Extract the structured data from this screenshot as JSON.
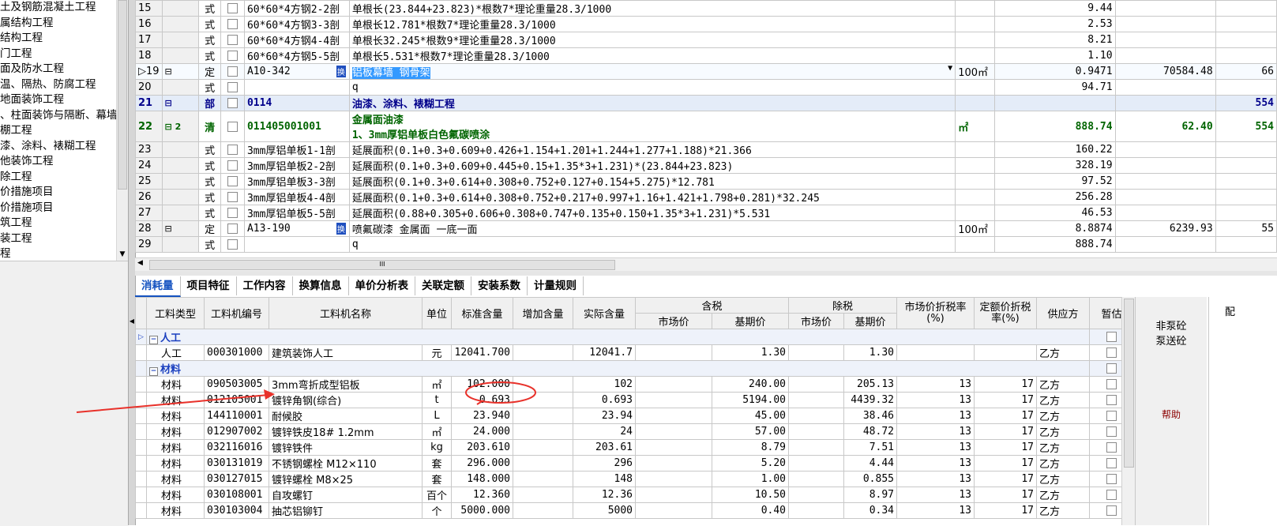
{
  "tree": {
    "items": [
      "土及钢筋混凝土工程",
      "属结构工程",
      "结构工程",
      "门工程",
      "面及防水工程",
      "温、隔热、防腐工程",
      "地面装饰工程",
      "、柱面装饰与隔断、幕墙",
      "棚工程",
      "漆、涂料、裱糊工程",
      "他装饰工程",
      "除工程",
      "价措施项目",
      "价措施项目",
      "筑工程",
      "装工程",
      "程"
    ]
  },
  "top_grid": {
    "rows": [
      {
        "num": "15",
        "indent": "",
        "type": "式",
        "code": "60*60*4方钢2-2剖",
        "name": "单根长(23.844+23.823)*根数7*理论重量28.3/1000",
        "unit": "",
        "qty": "9.44",
        "price": "",
        "extra": ""
      },
      {
        "num": "16",
        "indent": "",
        "type": "式",
        "code": "60*60*4方钢3-3剖",
        "name": "单根长12.781*根数7*理论重量28.3/1000",
        "unit": "",
        "qty": "2.53",
        "price": "",
        "extra": ""
      },
      {
        "num": "17",
        "indent": "",
        "type": "式",
        "code": "60*60*4方钢4-4剖",
        "name": "单根长32.245*根数9*理论重量28.3/1000",
        "unit": "",
        "qty": "8.21",
        "price": "",
        "extra": ""
      },
      {
        "num": "18",
        "indent": "",
        "type": "式",
        "code": "60*60*4方钢5-5剖",
        "name": "单根长5.531*根数7*理论重量28.3/1000",
        "unit": "",
        "qty": "1.10",
        "price": "",
        "extra": ""
      },
      {
        "num": "▷19",
        "indent": "⊟",
        "type": "定",
        "code": "A10-342",
        "tag": "换",
        "name": "铝板幕墙 钢骨架",
        "unit": "100㎡",
        "qty": "0.9471",
        "price": "70584.48",
        "extra": "66",
        "selected": true
      },
      {
        "num": "20",
        "indent": "",
        "type": "式",
        "code": "",
        "name": "q",
        "unit": "",
        "qty": "94.71",
        "price": "",
        "extra": ""
      },
      {
        "num": "21",
        "indent": "⊟",
        "type": "部",
        "code": "0114",
        "name": "油漆、涂料、裱糊工程",
        "unit": "",
        "qty": "",
        "price": "",
        "extra": "554",
        "dept": true
      },
      {
        "num": "22",
        "indent": "⊟ 2",
        "type": "清",
        "code": "011405001001",
        "name": "金属面油漆",
        "name2": "1、3mm厚铝单板白色氟碳喷涂",
        "unit": "㎡",
        "qty": "888.74",
        "price": "62.40",
        "extra": "554",
        "list": true
      },
      {
        "num": "23",
        "indent": "",
        "type": "式",
        "code": "3mm厚铝单板1-1剖",
        "name": "延展面积(0.1+0.3+0.609+0.426+1.154+1.201+1.244+1.277+1.188)*21.366",
        "unit": "",
        "qty": "160.22",
        "price": "",
        "extra": ""
      },
      {
        "num": "24",
        "indent": "",
        "type": "式",
        "code": "3mm厚铝单板2-2剖",
        "name": "延展面积(0.1+0.3+0.609+0.445+0.15+1.35*3+1.231)*(23.844+23.823)",
        "unit": "",
        "qty": "328.19",
        "price": "",
        "extra": ""
      },
      {
        "num": "25",
        "indent": "",
        "type": "式",
        "code": "3mm厚铝单板3-3剖",
        "name": "延展面积(0.1+0.3+0.614+0.308+0.752+0.127+0.154+5.275)*12.781",
        "unit": "",
        "qty": "97.52",
        "price": "",
        "extra": ""
      },
      {
        "num": "26",
        "indent": "",
        "type": "式",
        "code": "3mm厚铝单板4-4剖",
        "name": "延展面积(0.1+0.3+0.614+0.308+0.752+0.217+0.997+1.16+1.421+1.798+0.281)*32.245",
        "unit": "",
        "qty": "256.28",
        "price": "",
        "extra": ""
      },
      {
        "num": "27",
        "indent": "",
        "type": "式",
        "code": "3mm厚铝单板5-5剖",
        "name": "延展面积(0.88+0.305+0.606+0.308+0.747+0.135+0.150+1.35*3+1.231)*5.531",
        "unit": "",
        "qty": "46.53",
        "price": "",
        "extra": ""
      },
      {
        "num": "28",
        "indent": "⊟",
        "type": "定",
        "code": "A13-190",
        "tag": "换",
        "name": "喷氟碳漆 金属面 一底一面",
        "unit": "100㎡",
        "qty": "8.8874",
        "price": "6239.93",
        "extra": "55",
        "bold": false
      },
      {
        "num": "29",
        "indent": "",
        "type": "式",
        "code": "",
        "name": "q",
        "unit": "",
        "qty": "888.74",
        "price": "",
        "extra": ""
      }
    ]
  },
  "hscroll_grip": "III",
  "tabs": [
    "消耗量",
    "项目特征",
    "工作内容",
    "换算信息",
    "单价分析表",
    "关联定额",
    "安装系数",
    "计量规则"
  ],
  "bottom_grid": {
    "headers": {
      "type": "工料类型",
      "code": "工料机编号",
      "name": "工料机名称",
      "unit": "单位",
      "std": "标准含量",
      "add": "增加含量",
      "actual": "实际含量",
      "tax_group": "含税",
      "notax_group": "除税",
      "market": "市场价",
      "base": "基期价",
      "market2": "市场价",
      "base2": "基期价",
      "rate1": "市场价折税率(%)",
      "rate2": "定额价折税率(%)",
      "supplier": "供应方",
      "temp": "暂估"
    },
    "groups": [
      {
        "label": "人工",
        "rows": [
          {
            "type": "人工",
            "code": "000301000",
            "name": "建筑装饰人工",
            "unit": "元",
            "std": "12041.700",
            "add": "",
            "actual": "12041.7",
            "market": "",
            "base": "1.30",
            "market2": "",
            "base2": "1.30",
            "rate1": "",
            "rate2": "",
            "supplier": "乙方"
          }
        ]
      },
      {
        "label": "材料",
        "rows": [
          {
            "type": "材料",
            "code": "090503005",
            "name": "3mm弯折成型铝板",
            "unit": "㎡",
            "std": "102.000",
            "add": "",
            "actual": "102",
            "market": "",
            "base": "240.00",
            "market2": "",
            "base2": "205.13",
            "rate1": "13",
            "rate2": "17",
            "supplier": "乙方"
          },
          {
            "type": "材料",
            "code": "012105001",
            "name": "镀锌角钢(综合)",
            "unit": "t",
            "std": "0.693",
            "add": "",
            "actual": "0.693",
            "market": "",
            "base": "5194.00",
            "market2": "",
            "base2": "4439.32",
            "rate1": "13",
            "rate2": "17",
            "supplier": "乙方"
          },
          {
            "type": "材料",
            "code": "144110001",
            "name": "耐候胶",
            "unit": "L",
            "std": "23.940",
            "add": "",
            "actual": "23.94",
            "market": "",
            "base": "45.00",
            "market2": "",
            "base2": "38.46",
            "rate1": "13",
            "rate2": "17",
            "supplier": "乙方"
          },
          {
            "type": "材料",
            "code": "012907002",
            "name": "镀锌铁皮18# 1.2mm",
            "unit": "㎡",
            "std": "24.000",
            "add": "",
            "actual": "24",
            "market": "",
            "base": "57.00",
            "market2": "",
            "base2": "48.72",
            "rate1": "13",
            "rate2": "17",
            "supplier": "乙方"
          },
          {
            "type": "材料",
            "code": "032116016",
            "name": "镀锌铁件",
            "unit": "kg",
            "std": "203.610",
            "add": "",
            "actual": "203.61",
            "market": "",
            "base": "8.79",
            "market2": "",
            "base2": "7.51",
            "rate1": "13",
            "rate2": "17",
            "supplier": "乙方"
          },
          {
            "type": "材料",
            "code": "030131019",
            "name": "不锈钢螺栓 M12×110",
            "unit": "套",
            "std": "296.000",
            "add": "",
            "actual": "296",
            "market": "",
            "base": "5.20",
            "market2": "",
            "base2": "4.44",
            "rate1": "13",
            "rate2": "17",
            "supplier": "乙方"
          },
          {
            "type": "材料",
            "code": "030127015",
            "name": "镀锌螺栓 M8×25",
            "unit": "套",
            "std": "148.000",
            "add": "",
            "actual": "148",
            "market": "",
            "base": "1.00",
            "market2": "",
            "base2": "0.855",
            "rate1": "13",
            "rate2": "17",
            "supplier": "乙方"
          },
          {
            "type": "材料",
            "code": "030108001",
            "name": "自攻螺钉",
            "unit": "百个",
            "std": "12.360",
            "add": "",
            "actual": "12.36",
            "market": "",
            "base": "10.50",
            "market2": "",
            "base2": "8.97",
            "rate1": "13",
            "rate2": "17",
            "supplier": "乙方"
          },
          {
            "type": "材料",
            "code": "030103004",
            "name": "抽芯铝铆钉",
            "unit": "个",
            "std": "5000.000",
            "add": "",
            "actual": "5000",
            "market": "",
            "base": "0.40",
            "market2": "",
            "base2": "0.34",
            "rate1": "13",
            "rate2": "17",
            "supplier": "乙方"
          }
        ]
      }
    ]
  },
  "right_panel": {
    "btn1": "非泵砼",
    "btn2": "泵送砼",
    "help": "帮助"
  },
  "far_right": {
    "label": "配"
  },
  "colors": {
    "arrow": "#e8312a",
    "help": "#8b0000",
    "list_green": "#006400",
    "dept_blue": "#00008b",
    "tab_blue": "#1452c0"
  }
}
